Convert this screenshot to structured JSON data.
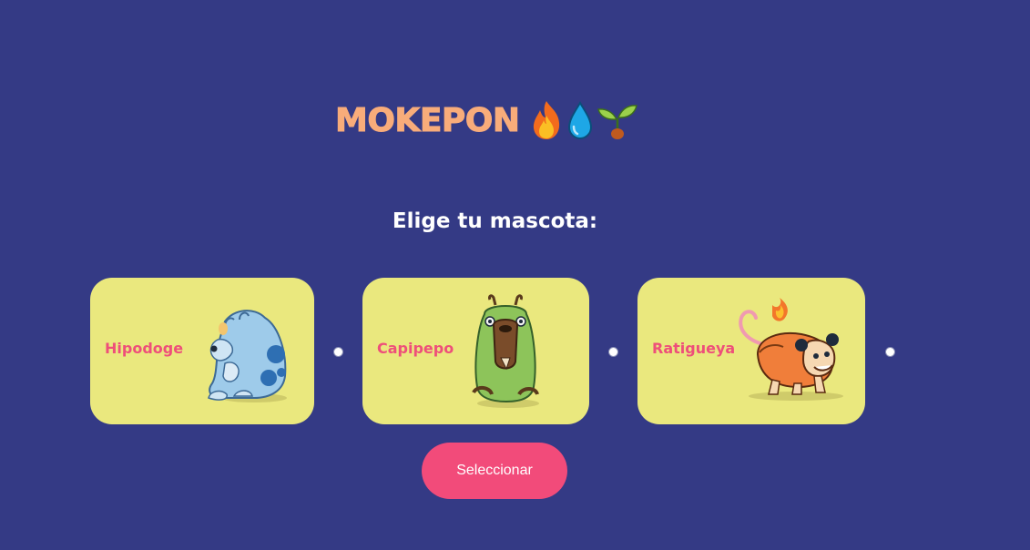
{
  "header": {
    "title": "MOKEPON",
    "icons": [
      "fire-icon",
      "water-drop-icon",
      "sprout-icon"
    ]
  },
  "subtitle": "Elige tu mascota:",
  "pets": [
    {
      "name": "Hipodoge",
      "image": "hipodoge-image"
    },
    {
      "name": "Capipepo",
      "image": "capipepo-image"
    },
    {
      "name": "Ratigueya",
      "image": "ratigueya-image"
    }
  ],
  "select_button": "Seleccionar",
  "colors": {
    "background": "#343A85",
    "title": "#F8AC7A",
    "card": "#EAE87E",
    "pet_name": "#EE4F7A",
    "button": "#F24B7A"
  }
}
